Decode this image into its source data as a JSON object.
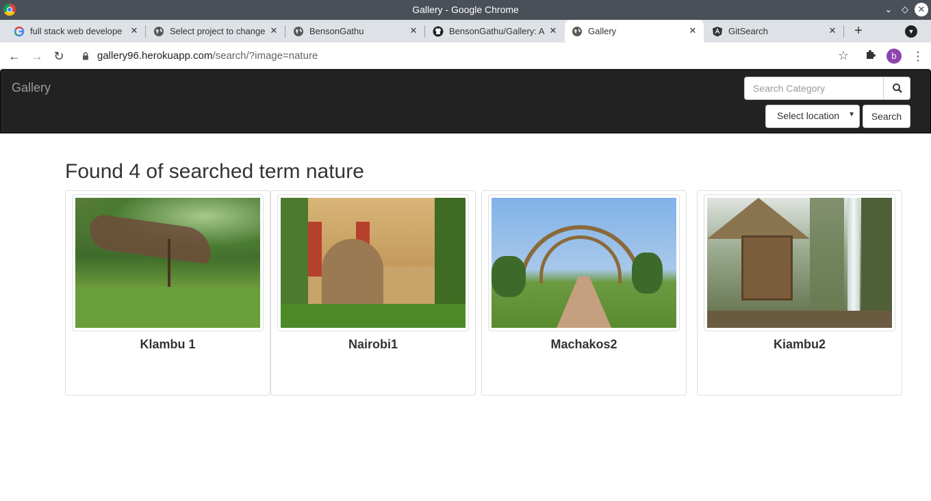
{
  "window": {
    "title": "Gallery - Google Chrome"
  },
  "tabs": [
    {
      "title": "full stack web develope",
      "favicon": "google-icon",
      "active": false
    },
    {
      "title": "Select project to change",
      "favicon": "globe-icon",
      "active": false
    },
    {
      "title": "BensonGathu",
      "favicon": "globe-icon",
      "active": false
    },
    {
      "title": "BensonGathu/Gallery: A",
      "favicon": "github-icon",
      "active": false
    },
    {
      "title": "Gallery",
      "favicon": "globe-icon",
      "active": true
    },
    {
      "title": "GitSearch",
      "favicon": "angular-icon",
      "active": false
    }
  ],
  "address": {
    "host": "gallery96.herokuapp.com",
    "path": "/search/?image=nature"
  },
  "profile": {
    "initial": "b"
  },
  "navbar": {
    "brand": "Gallery",
    "search_placeholder": "Search Category",
    "location_label": "Select location",
    "search_button": "Search"
  },
  "results": {
    "heading": "Found 4 of searched term nature",
    "cards": [
      {
        "title": "Klambu 1"
      },
      {
        "title": "Nairobi1"
      },
      {
        "title": "Machakos2"
      },
      {
        "title": "Kiambu2"
      }
    ]
  }
}
